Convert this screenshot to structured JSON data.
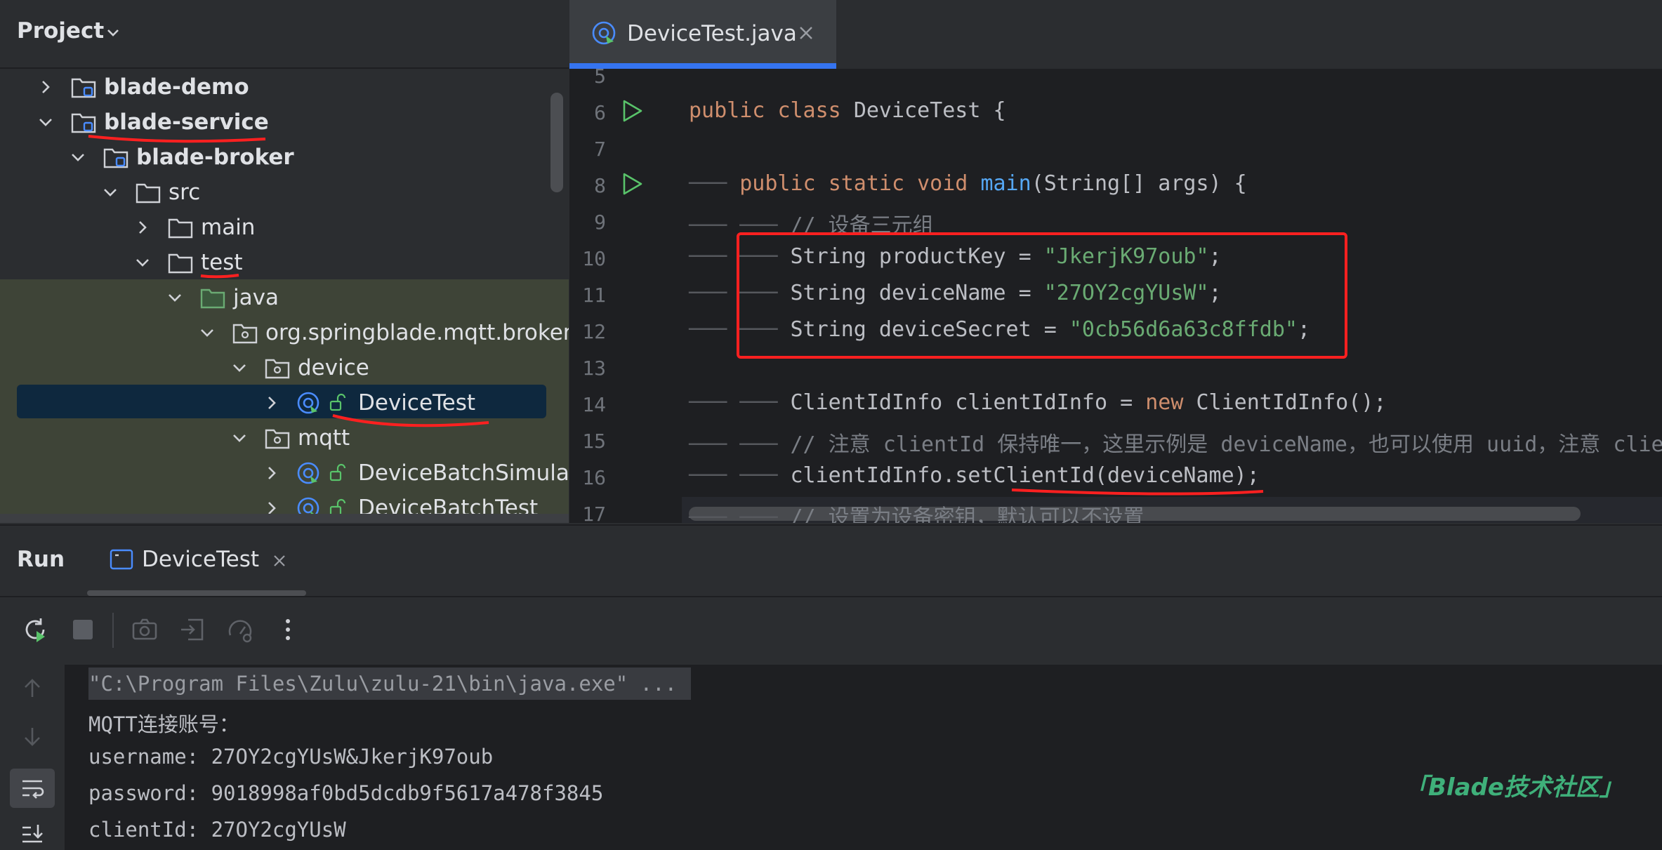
{
  "project_panel": {
    "title": "Project",
    "tree": [
      {
        "label": "blade-demo",
        "level": 0,
        "expanded": false,
        "type": "module"
      },
      {
        "label": "blade-service",
        "level": 0,
        "expanded": true,
        "type": "module"
      },
      {
        "label": "blade-broker",
        "level": 1,
        "expanded": true,
        "type": "module"
      },
      {
        "label": "src",
        "level": 2,
        "expanded": true,
        "type": "folder"
      },
      {
        "label": "main",
        "level": 3,
        "expanded": false,
        "type": "folder"
      },
      {
        "label": "test",
        "level": 3,
        "expanded": true,
        "type": "folder"
      },
      {
        "label": "java",
        "level": 4,
        "expanded": true,
        "type": "test-source-folder"
      },
      {
        "label": "org.springblade.mqtt.broker",
        "level": 5,
        "expanded": true,
        "type": "package"
      },
      {
        "label": "device",
        "level": 6,
        "expanded": true,
        "type": "package"
      },
      {
        "label": "DeviceTest",
        "level": 7,
        "expanded": false,
        "type": "class",
        "selected": true
      },
      {
        "label": "mqtt",
        "level": 6,
        "expanded": true,
        "type": "package"
      },
      {
        "label": "DeviceBatchSimulato",
        "level": 7,
        "expanded": false,
        "type": "class"
      },
      {
        "label": "DeviceBatchTest",
        "level": 7,
        "expanded": false,
        "type": "class"
      }
    ]
  },
  "editor": {
    "tab_label": "DeviceTest.java",
    "line_numbers": [
      "5",
      "6",
      "7",
      "8",
      "9",
      "10",
      "11",
      "12",
      "13",
      "14",
      "15",
      "16",
      "17"
    ],
    "code": {
      "l6_kw1": "public",
      "l6_kw2": "class",
      "l6_name": "DeviceTest {",
      "l8_kw1": "public",
      "l8_kw2": "static",
      "l8_kw3": "void",
      "l8_fn": "main",
      "l8_rest": "(String[] args) {",
      "l9_comment": "// 设备三元组",
      "l10_type": "String productKey =",
      "l10_value": "\"JkerjK97oub\"",
      "l11_type": "String deviceName =",
      "l11_value": "\"27OY2cgYUsW\"",
      "l12_type": "String deviceSecret =",
      "l12_value": "\"0cb56d6a63c8ffdb\"",
      "l14_a": "ClientIdInfo clientIdInfo =",
      "l14_kw": "new",
      "l14_b": "ClientIdInfo();",
      "l15_comment": "// 注意 clientId 保持唯一，这里示例是 deviceName，也可以使用 uuid，注意 clie",
      "l16": "clientIdInfo.setClientId(deviceName);",
      "l17_comment": "// 设置为设备密钥，默认可以不设置"
    }
  },
  "run_panel": {
    "title": "Run",
    "tab_label": "DeviceTest",
    "console": [
      "\"C:\\Program Files\\Zulu\\zulu-21\\bin\\java.exe\" ...",
      "MQTT连接账号：",
      "username: 27OY2cgYUsW&JkerjK97oub",
      "password: 9018998af0bd5dcdb9f5617a478f3845",
      "clientId: 27OY2cgYUsW"
    ]
  },
  "watermark": "「Blade技术社区」",
  "colors": {
    "accent": "#3574f0",
    "annotation": "#ff2020",
    "keyword": "#cf8e6d",
    "string": "#6aab73",
    "function": "#56a8f5",
    "comment": "#7a7e85"
  }
}
